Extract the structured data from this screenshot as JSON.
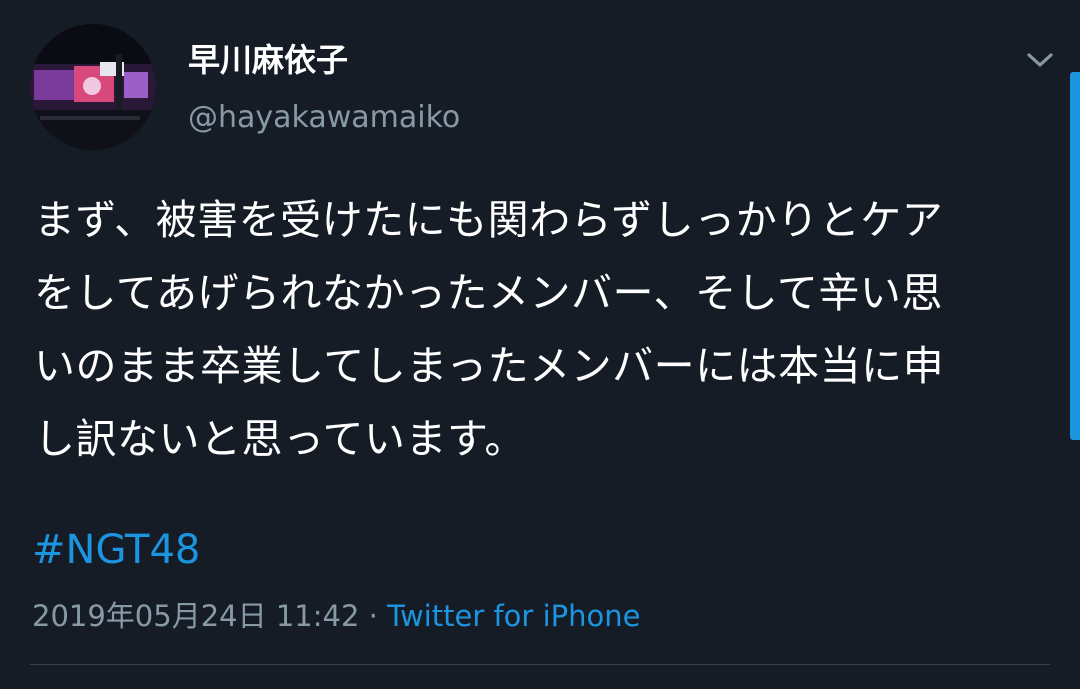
{
  "user": {
    "display_name": "早川麻依子",
    "handle": "@hayakawamaiko"
  },
  "tweet": {
    "lines": [
      "まず、被害を受けたにも関わらずしっかりとケア",
      "をしてあげられなかったメンバー、そして辛い思",
      "いのまま卒業してしまったメンバーには本当に申",
      "し訳ないと思っています。"
    ],
    "hashtag": "#NGT48",
    "timestamp": "2019年05月24日 11:42",
    "separator": "·",
    "source": "Twitter for iPhone"
  },
  "icons": {
    "menu": "chevron-down-icon",
    "avatar": "stage-photo"
  },
  "colors": {
    "background": "#151c26",
    "text": "#ffffff",
    "secondary": "#8899a6",
    "accent": "#1b95e0",
    "divider": "#38444d"
  }
}
